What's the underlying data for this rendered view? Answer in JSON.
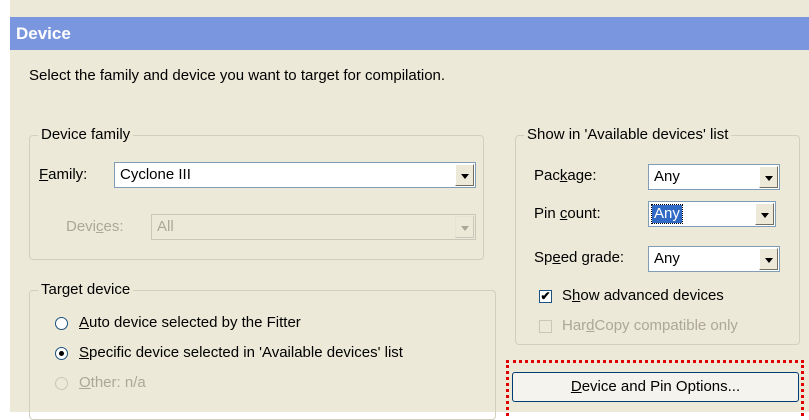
{
  "dialog": {
    "title": "Device",
    "description": "Select the family and device you want to target for compilation."
  },
  "device_family": {
    "legend": "Device family",
    "family_label_u": "F",
    "family_label_rest": "amily:",
    "family_value": "Cyclone III",
    "devices_label_pre": "Devi",
    "devices_label_u": "c",
    "devices_label_post": "es:",
    "devices_value": "All"
  },
  "target_device": {
    "legend": "Target device",
    "option1_u": "A",
    "option1_rest": "uto device selected by the Fitter",
    "option2_u": "S",
    "option2_rest": "pecific device selected in 'Available devices' list",
    "option3_u": "O",
    "option3_rest": "ther:  n/a"
  },
  "show_list": {
    "legend": "Show in 'Available devices' list",
    "package_pre": "Pac",
    "package_u": "k",
    "package_post": "age:",
    "package_value": "Any",
    "pin_pre": "Pin ",
    "pin_u": "c",
    "pin_post": "ount:",
    "pin_value": "Any",
    "speed_pre": "Sp",
    "speed_u": "e",
    "speed_post": "ed grade:",
    "speed_value": "Any",
    "show_adv_pre": "S",
    "show_adv_u": "h",
    "show_adv_post": "ow advanced devices",
    "hardcopy_pre": "Har",
    "hardcopy_u": "d",
    "hardcopy_post": "Copy compatible only"
  },
  "buttons": {
    "options_u": "D",
    "options_rest": "evice and Pin Options..."
  },
  "icons": {
    "dropdown": "chevron-down-icon",
    "checkmark": "check-icon"
  },
  "colors": {
    "titlebar": "#7a96df",
    "highlight": "#e00000",
    "selection": "#316ac5"
  }
}
